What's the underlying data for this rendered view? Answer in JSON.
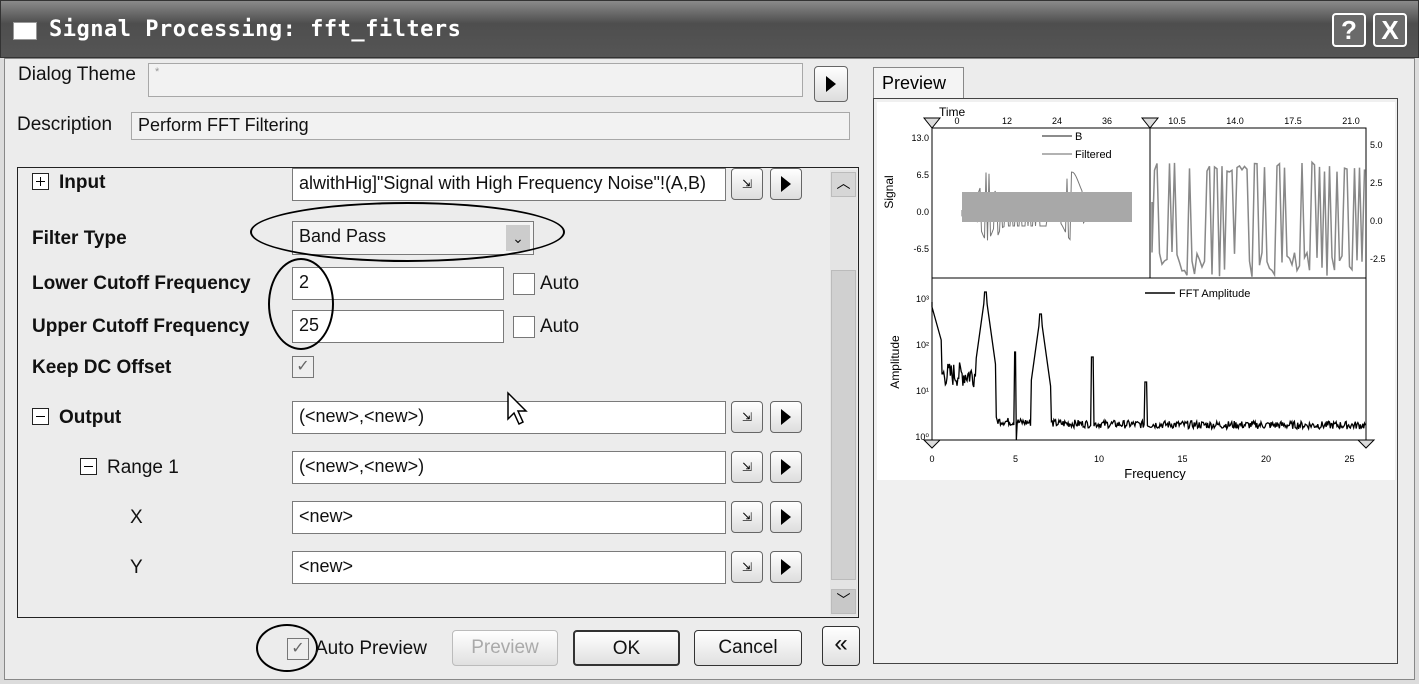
{
  "window": {
    "title": "Signal Processing: fft_filters",
    "help": "?",
    "close": "X"
  },
  "dialog_theme": {
    "label": "Dialog Theme",
    "value": "*"
  },
  "description": {
    "label": "Description",
    "value": "Perform FFT Filtering"
  },
  "tree": {
    "input": {
      "label": "Input",
      "value": "alwithHig]\"Signal with High Frequency Noise\"!(A,B)"
    },
    "filter_type": {
      "label": "Filter Type",
      "value": "Band Pass"
    },
    "lower": {
      "label": "Lower Cutoff Frequency",
      "value": "2",
      "auto_label": "Auto",
      "auto": false
    },
    "upper": {
      "label": "Upper Cutoff Frequency",
      "value": "25",
      "auto_label": "Auto",
      "auto": false
    },
    "keep_dc": {
      "label": "Keep DC Offset",
      "checked": true
    },
    "output": {
      "label": "Output",
      "value": "(<new>,<new>)"
    },
    "range1": {
      "label": "Range 1",
      "value": "(<new>,<new>)"
    },
    "x": {
      "label": "X",
      "value": "<new>"
    },
    "y": {
      "label": "Y",
      "value": "<new>"
    }
  },
  "bottom": {
    "auto_preview_label": "Auto Preview",
    "auto_preview": true,
    "preview": "Preview",
    "ok": "OK",
    "cancel": "Cancel",
    "collapse": "«"
  },
  "preview": {
    "tab": "Preview",
    "top": {
      "xlabel": "Time",
      "ylabel": "Signal",
      "legend": [
        "B",
        "Filtered"
      ],
      "left_xticks": [
        "0",
        "12",
        "24",
        "36"
      ],
      "right_xticks": [
        "10.5",
        "14.0",
        "17.5",
        "21.0"
      ],
      "left_yticks": [
        "13.0",
        "6.5",
        "0.0",
        "-6.5"
      ],
      "right_yticks": [
        "5.0",
        "2.5",
        "0.0",
        "-2.5"
      ]
    },
    "bottom": {
      "xlabel": "Frequency",
      "ylabel": "Amplitude",
      "legend": "FFT Amplitude",
      "xticks": [
        "0",
        "5",
        "10",
        "15",
        "20",
        "25"
      ],
      "yticks": [
        "10³",
        "10²",
        "10¹",
        "10⁰"
      ]
    }
  }
}
